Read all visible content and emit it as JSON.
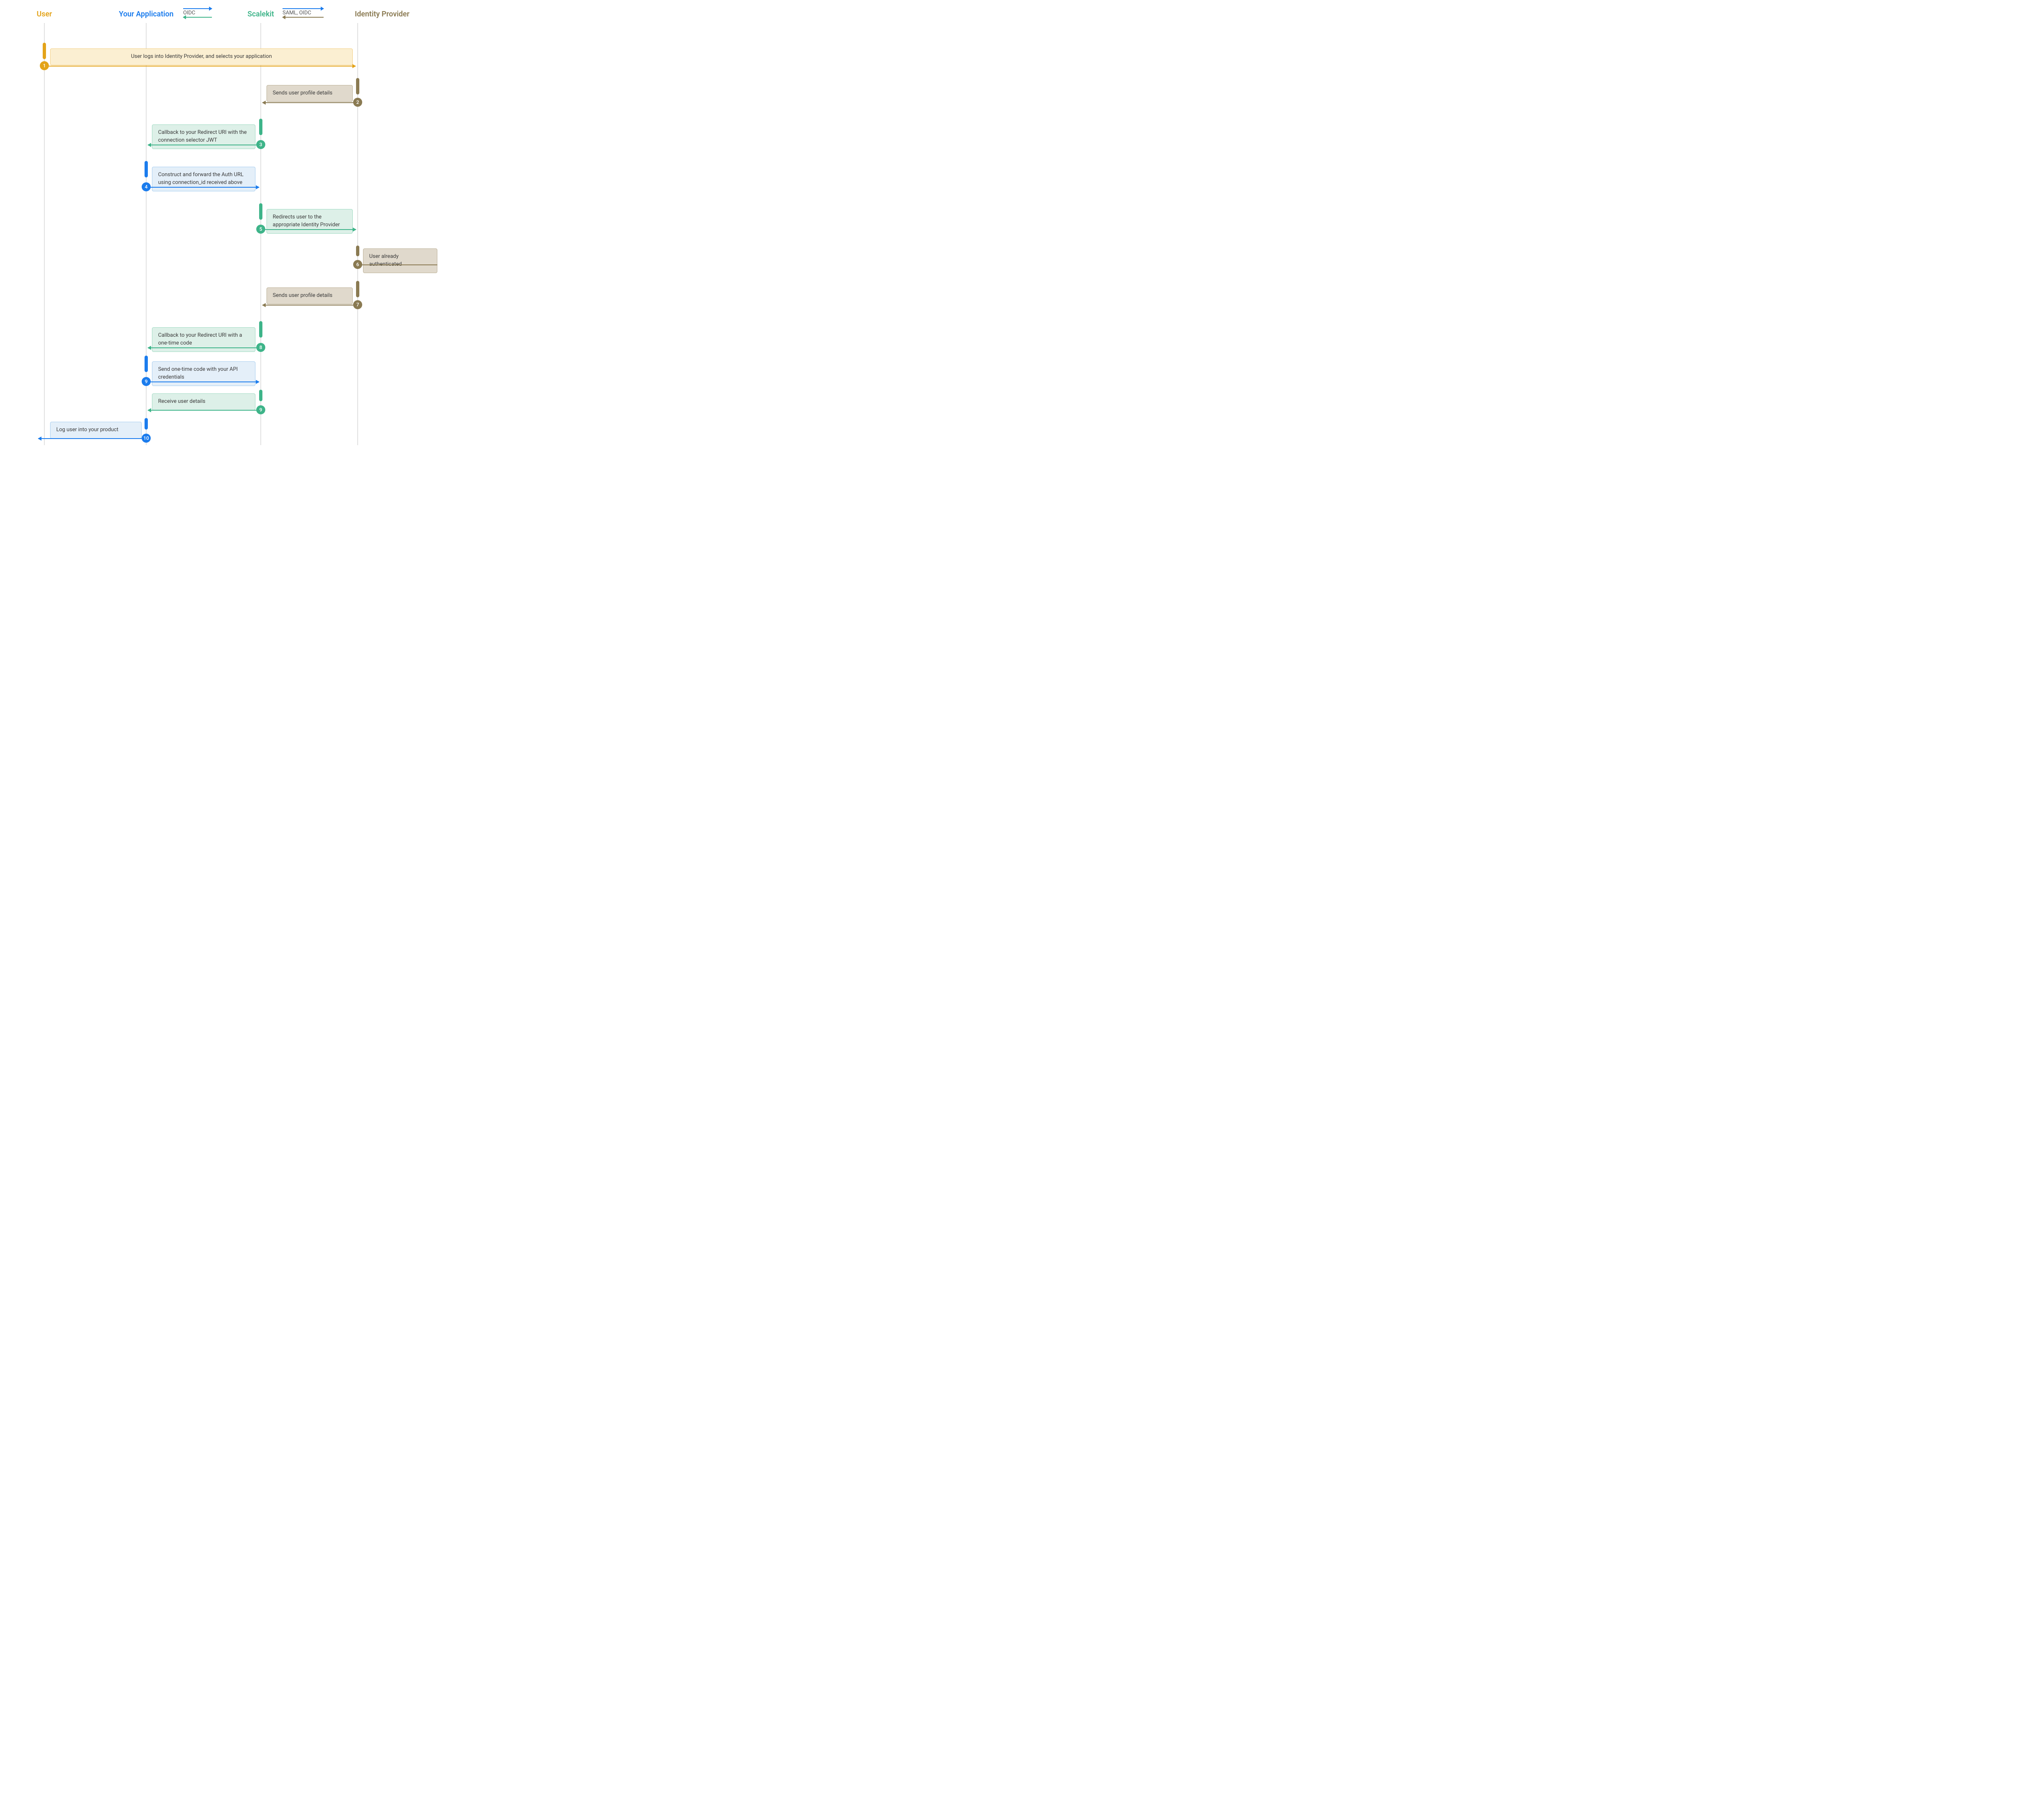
{
  "lanes": {
    "user": "User",
    "app": "Your Application",
    "scalekit": "Scalekit",
    "idp": "Identity Provider"
  },
  "legend": {
    "app_scalekit": "OIDC",
    "scalekit_idp": "SAML, OIDC"
  },
  "steps": {
    "s1": {
      "n": "1",
      "text": "User logs into Identity Provider, and selects your application"
    },
    "s2": {
      "n": "2",
      "text": "Sends user profile details"
    },
    "s3": {
      "n": "3",
      "text": "Callback to your Redirect URI with the connection selector JWT"
    },
    "s4": {
      "n": "4",
      "text": "Construct and forward the Auth URL using connection_id received above"
    },
    "s5": {
      "n": "5",
      "text": "Redirects user to the appropriate Identity Provider"
    },
    "s6": {
      "n": "6",
      "text": "User already authenticated"
    },
    "s7": {
      "n": "7",
      "text": "Sends user profile details"
    },
    "s8": {
      "n": "8",
      "text": "Callback to your Redirect URI with a one-time code"
    },
    "s9": {
      "n": "9",
      "text": "Send one-time code with your API credentials"
    },
    "s10": {
      "n": "9",
      "text": "Receive user details"
    },
    "s11": {
      "n": "10",
      "text": "Log user into your product"
    }
  }
}
